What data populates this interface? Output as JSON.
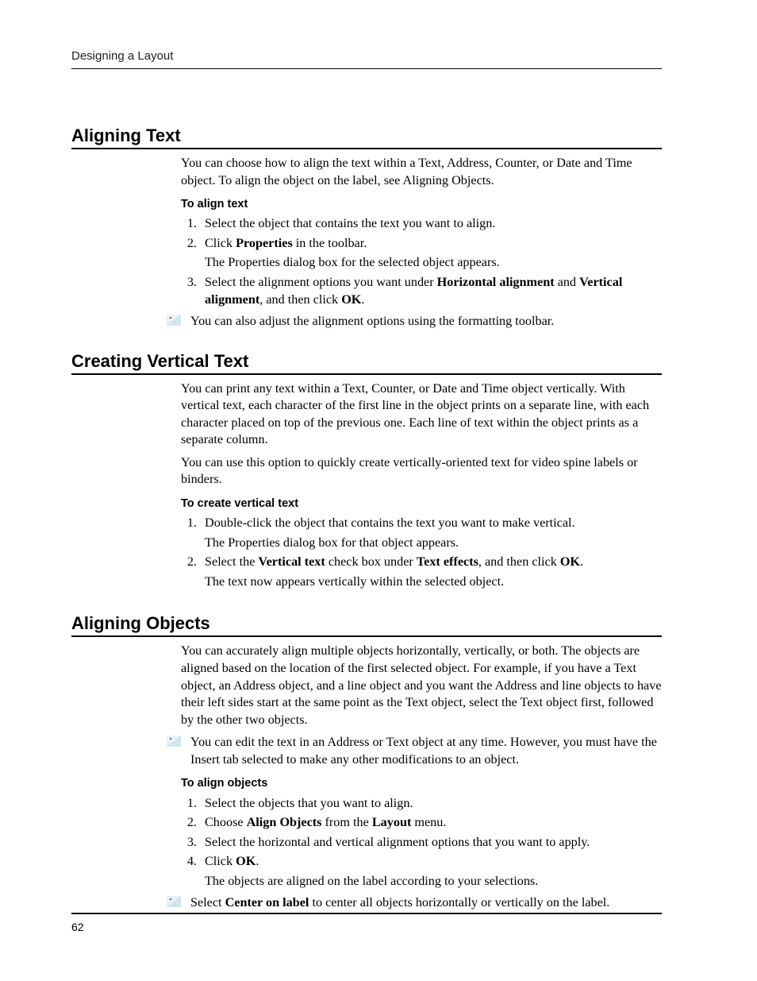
{
  "running_head": "Designing a Layout",
  "page_number": "62",
  "s1": {
    "title": "Aligning Text",
    "intro": "You can choose how to align the text within a Text, Address, Counter, or Date and Time object. To align the object on the label, see Aligning Objects.",
    "sub": "To align text",
    "step1": "Select the object that contains the text you want to align.",
    "step2_a": "Click ",
    "step2_b": "Properties",
    "step2_c": " in the toolbar.",
    "step2_after": "The Properties dialog box for the selected object appears.",
    "step3_a": "Select the alignment options you want under ",
    "step3_b": "Horizontal alignment",
    "step3_c": " and ",
    "step3_d": "Vertical alignment",
    "step3_e": ", and then click ",
    "step3_f": "OK",
    "step3_g": ".",
    "note": "You can also adjust the alignment options using the formatting toolbar."
  },
  "s2": {
    "title": "Creating Vertical Text",
    "intro1": "You can print any text within a Text, Counter, or Date and Time object vertically. With vertical text, each character of the first line in the object prints on a separate line, with each character placed on top of the previous one. Each line of text within the object prints as a separate column.",
    "intro2": "You can use this option to quickly create vertically-oriented text for video spine labels or binders.",
    "sub": "To create vertical text",
    "step1": "Double-click the object that contains the text you want to make vertical.",
    "step1_after": "The Properties dialog box for that object appears.",
    "step2_a": "Select the ",
    "step2_b": "Vertical text",
    "step2_c": " check box under ",
    "step2_d": "Text effects",
    "step2_e": ", and then click ",
    "step2_f": "OK",
    "step2_g": ".",
    "step2_after": "The text now appears vertically within the selected object."
  },
  "s3": {
    "title": "Aligning Objects",
    "intro": "You can accurately align multiple objects horizontally, vertically, or both. The objects are aligned based on the location of the first selected object. For example, if you have a Text object, an Address object, and a line object and you want the Address and line objects to have their left sides start at the same point as the Text object, select the Text object first, followed by the other two objects.",
    "note1": "You can edit the text in an Address or Text object at any time. However, you must have the Insert tab selected to make any other modifications to an object.",
    "sub": "To align objects",
    "step1": "Select the objects that you want to align.",
    "step2_a": "Choose ",
    "step2_b": "Align Objects",
    "step2_c": " from the ",
    "step2_d": "Layout",
    "step2_e": " menu.",
    "step3": "Select the horizontal and vertical alignment options that you want to apply.",
    "step4_a": "Click ",
    "step4_b": "OK",
    "step4_c": ".",
    "step4_after": "The objects are aligned on the label according to your selections.",
    "note2_a": "Select ",
    "note2_b": "Center on label",
    "note2_c": " to center all objects horizontally or vertically on the label."
  }
}
